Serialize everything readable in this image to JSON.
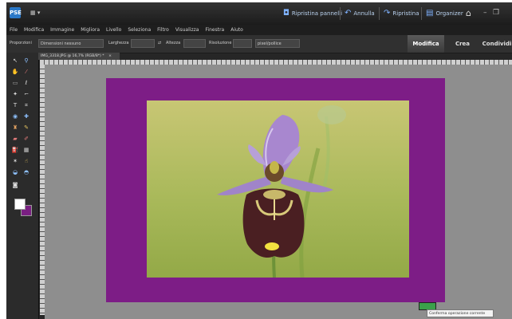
{
  "titlebar": {
    "logo_text": "PSE",
    "buttons": [
      {
        "label": "Ripristina pannelli",
        "icon": "panels-icon"
      },
      {
        "label": "Annulla",
        "icon": "undo-icon"
      },
      {
        "label": "Ripristina",
        "icon": "redo-icon"
      },
      {
        "label": "Organizer",
        "icon": "organizer-icon"
      }
    ]
  },
  "menu": [
    "File",
    "Modifica",
    "Immagine",
    "Migliora",
    "Livello",
    "Seleziona",
    "Filtro",
    "Visualizza",
    "Finestra",
    "Aiuto"
  ],
  "options_bar": {
    "preset_label": "Proporzioni",
    "preset_value": "Dimensioni nessuno",
    "width_label": "Larghezza",
    "height_label": "Altezza",
    "resolution_label": "Risoluzione",
    "unit_value": "pixel/pollice"
  },
  "mode_tabs": [
    {
      "label": "Modifica",
      "active": true
    },
    {
      "label": "Crea",
      "active": false
    },
    {
      "label": "Condividi",
      "active": false
    }
  ],
  "document": {
    "tab_title": "IMG_3318.JPG @ 16,7% (RGB/8*) *",
    "tab_close": "×"
  },
  "colors": {
    "foreground": "#ffffff",
    "background": "#7a1f82",
    "frame": "#7d1d86",
    "workspace": "#8e8e8e"
  },
  "tooltip": "Conferma operazione corrente"
}
